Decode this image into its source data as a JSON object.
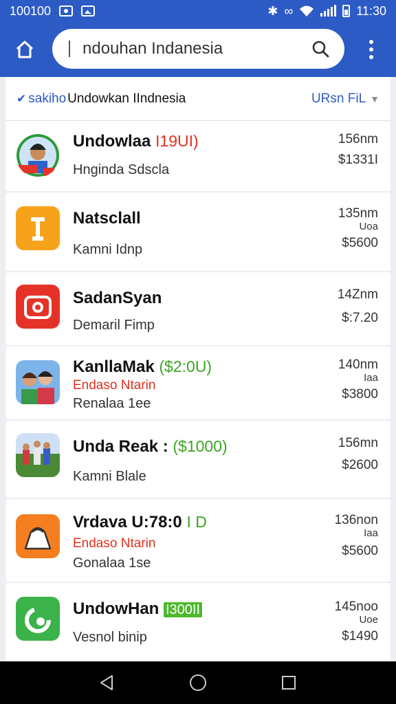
{
  "status_bar": {
    "network_text": "100100",
    "time": "11:30",
    "icons": [
      "eye-icon",
      "image-icon",
      "bluetooth-icon",
      "link-icon",
      "wifi-icon",
      "signal-icon",
      "battery-icon"
    ]
  },
  "header": {
    "search_value": "ndouhan Indanesia",
    "icons": [
      "home-icon",
      "search-icon",
      "more-vert-icon"
    ],
    "accent_color": "#2d5bc6"
  },
  "filter_bar": {
    "crumb_prefix": "sakiho",
    "crumb_text": "Undowkan IIndnesia",
    "filter_label": "URsn FiL"
  },
  "items": [
    {
      "title": "Undowlaa",
      "tag": "I19UI)",
      "status": "",
      "sub": "Hnginda Sdscla",
      "dist": "156nm",
      "unit": "",
      "price": "$1331I",
      "icon": "portrait-flag-icon"
    },
    {
      "title": "Natsclall",
      "tag": "",
      "status": "",
      "sub": "Kamni Idnp",
      "dist": "135nm",
      "unit": "Uoa",
      "price": "$5600",
      "icon": "flag-app-icon"
    },
    {
      "title": "SadanSyan",
      "tag": "",
      "status": "",
      "sub": "Demaril Fimp",
      "dist": "14Znm",
      "unit": "",
      "price": "$:7.20",
      "icon": "camera-app-icon"
    },
    {
      "title": "KanllaMak",
      "tag": "($2:0U)",
      "status": "Endaso Ntarin",
      "sub": "Renalaa 1ee",
      "dist": "140nm",
      "unit": "Iaa",
      "price": "$3800",
      "icon": "kids-photo-icon"
    },
    {
      "title": "Unda Reak :",
      "tag": "($1000)",
      "status": "",
      "sub": "Kamni Blale",
      "dist": "156mn",
      "unit": "",
      "price": "$2600",
      "icon": "field-photo-icon"
    },
    {
      "title": "Vrdava U:78:0",
      "tag": "I D",
      "status": "Endaso Ntarin",
      "sub": "Gonalaa 1se",
      "dist": "136non",
      "unit": "Iaa",
      "price": "$5600",
      "icon": "bag-app-icon"
    },
    {
      "title": "UndowHan",
      "tag": "I300II",
      "status": "",
      "sub": "Vesnol binip",
      "dist": "145noo",
      "unit": "Uoe",
      "price": "$1490",
      "icon": "green-swirl-app-icon"
    }
  ],
  "nav": {
    "icons": [
      "back-icon",
      "home-circle-icon",
      "recents-icon"
    ]
  }
}
